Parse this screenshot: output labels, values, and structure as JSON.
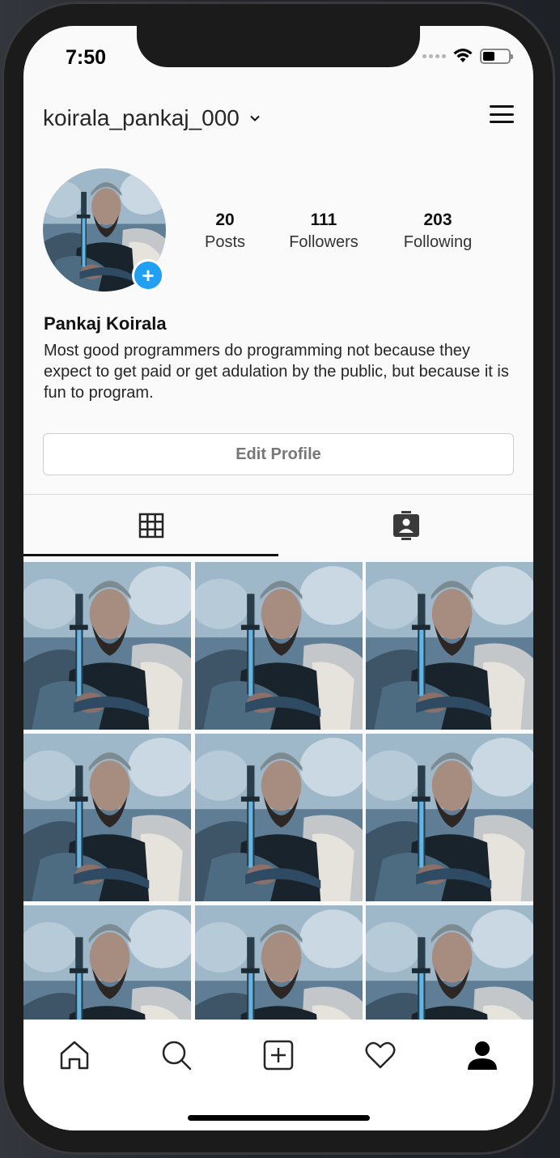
{
  "status_bar": {
    "time": "7:50"
  },
  "header": {
    "username": "koirala_pankaj_000"
  },
  "profile": {
    "stats": [
      {
        "value": "20",
        "label": "Posts"
      },
      {
        "value": "111",
        "label": "Followers"
      },
      {
        "value": "203",
        "label": "Following"
      }
    ],
    "full_name": "Pankaj Koirala",
    "bio": "Most good programmers do programming not because they expect to get paid or get adulation by the public, but because it is fun to program.",
    "edit_button_label": "Edit Profile"
  },
  "tabs": [
    {
      "icon": "grid-icon",
      "active": true
    },
    {
      "icon": "tagged-contact-icon",
      "active": false
    }
  ],
  "posts_count_visible": 9,
  "bottom_nav": [
    "home-icon",
    "search-icon",
    "add-post-icon",
    "activity-heart-icon",
    "profile-icon"
  ],
  "colors": {
    "accent_blue": "#1fa0f2",
    "background": "#fafafa"
  }
}
